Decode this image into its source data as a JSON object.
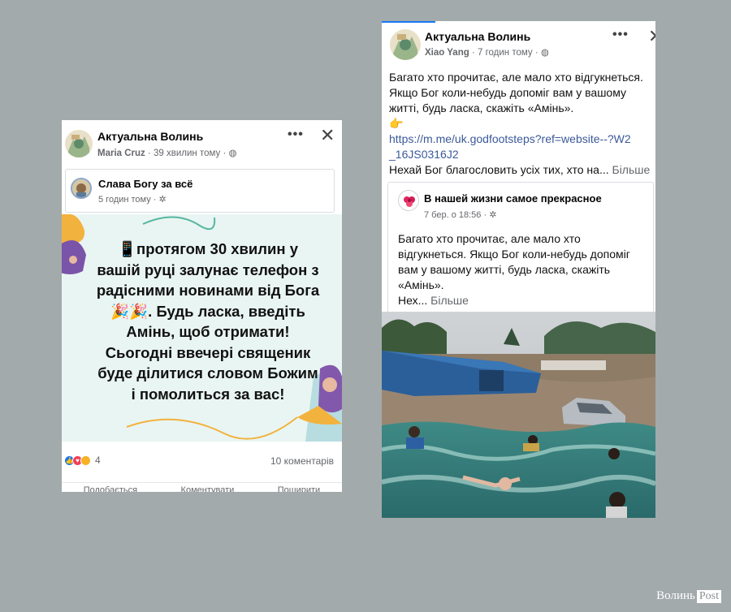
{
  "left_post": {
    "page_name": "Актуальна Волинь",
    "author": "Maria Cruz",
    "time": "· 39 хвилин тому ·",
    "shared": {
      "name": "Слава Богу за всё",
      "time": "5 годин тому ·"
    },
    "image_text": "📱протягом 30 хвилин у вашій руці залунає телефон з радісними новинами від Бога🎉🎉. Будь ласка, введіть Амінь, щоб отримати! Сьогодні ввечері священик буде ділитися словом Божим і помолиться за вас!",
    "reaction_count": "4",
    "comments": "10 коментарів",
    "actions": [
      "Подобається",
      "Коментувати",
      "Поширити"
    ]
  },
  "right_post": {
    "page_name": "Актуальна Волинь",
    "author": "Xiao Yang",
    "time": "· 7 годин тому ·",
    "text_line1": "Багато хто прочитає, але мало хто відгукнеться.",
    "text_line2": "Якщо Бог коли-небудь допоміг вам у вашому",
    "text_line3": "житті, будь ласка, скажіть «Амінь».",
    "pointing_emoji": "👉",
    "link_line1": "https://m.me/uk.godfootsteps?ref=website--?W2",
    "link_line2": "_16JS0316J2",
    "bless_text": "Нехай Бог благословить усіх тих, хто на...",
    "more_label": "Більше",
    "shared": {
      "name": "В нашей жизни самое прекрасное",
      "time": "7 бер. о 18:56 ·",
      "text_line1": "Багато хто прочитає, але мало хто",
      "text_line2": "відгукнеться. Якщо Бог коли-небудь допоміг",
      "text_line3": "вам у вашому житті, будь ласка, скажіть",
      "text_line4": "«Амінь».",
      "text_tail": "Нех...",
      "more_label": "Більше"
    }
  },
  "watermark": {
    "brand": "Волинь",
    "suffix": "Post"
  },
  "colors": {
    "background": "#a3aaab",
    "link": "#3b5998",
    "meta": "#65676b"
  }
}
